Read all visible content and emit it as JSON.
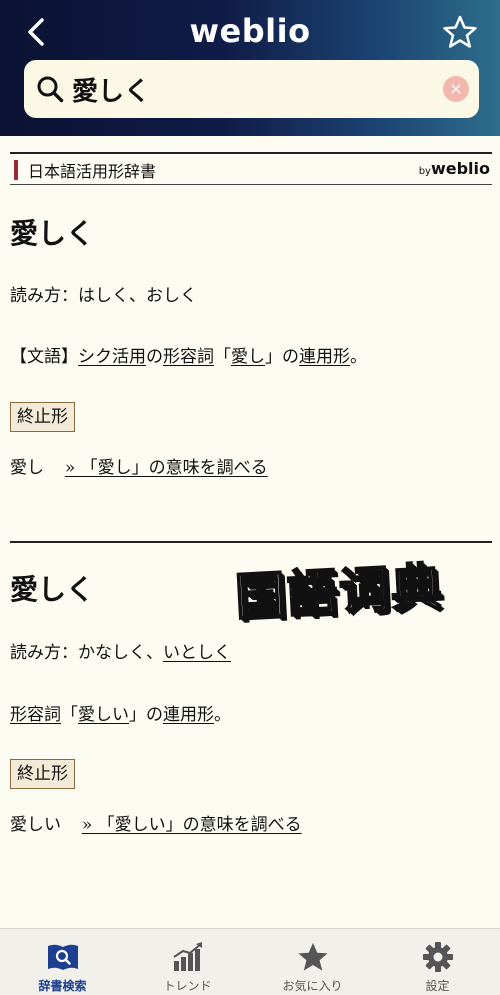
{
  "header": {
    "title": "weblio",
    "search_query": "愛しく",
    "clear_label": "×"
  },
  "dictionary": {
    "name": "日本語活用形辞書",
    "by": "by",
    "brand": "weblio"
  },
  "entries": [
    {
      "headword": "愛しく",
      "reading_prefix": "読み方：はしく、おしく",
      "definition": {
        "open": "【文語】",
        "link1": "シク活用",
        "mid1": "の",
        "link2": "形容詞",
        "mid2": "「",
        "link3": "愛し",
        "mid3": "」の",
        "link4": "連用形",
        "end": "。"
      },
      "tag": "終止形",
      "base_word": "愛し",
      "lookup_link": "» 「愛し」の意味を調べる"
    },
    {
      "headword": "愛しく",
      "reading_prefix": "読み方：かなしく、",
      "reading_link": "いとしく",
      "definition": {
        "link1": "形容詞",
        "mid1": "「",
        "link2": "愛しい",
        "mid2": "」の",
        "link3": "連用形",
        "end": "。"
      },
      "tag": "終止形",
      "base_word": "愛しい",
      "lookup_link": "» 「愛しい」の意味を調べる"
    }
  ],
  "stamp_text": "国語词典",
  "tabbar": {
    "tabs": [
      {
        "label": "辞書検索",
        "icon": "dictionary-search-icon",
        "active": true
      },
      {
        "label": "トレンド",
        "icon": "trend-chart-icon",
        "active": false
      },
      {
        "label": "お気に入り",
        "icon": "star-icon",
        "active": false
      },
      {
        "label": "設定",
        "icon": "gear-icon",
        "active": false
      }
    ]
  },
  "colors": {
    "header_gradient_start": "#0b1232",
    "header_gradient_end": "#2e6e8c",
    "background": "#fdfcf3",
    "accent": "#9c2a3d",
    "active_tab": "#1d3f8f"
  }
}
